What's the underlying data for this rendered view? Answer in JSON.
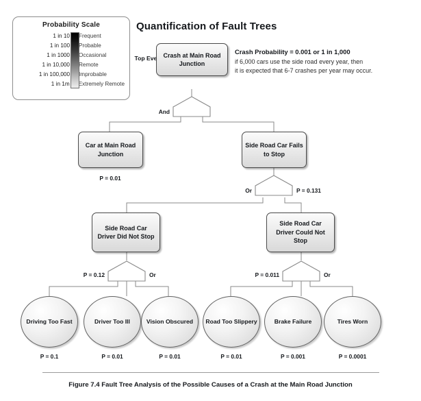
{
  "page": {
    "title": "Quantification of Fault Trees",
    "caption": "Figure 7.4 Fault Tree Analysis of the Possible Causes of a Crash at the Main Road Junction"
  },
  "legend": {
    "title": "Probability Scale",
    "rows": [
      {
        "ratio": "1 in 10",
        "word": "Frequent"
      },
      {
        "ratio": "1 in 100",
        "word": "Probable"
      },
      {
        "ratio": "1 in 1000",
        "word": "Occasional"
      },
      {
        "ratio": "1 in 10,000",
        "word": "Remote"
      },
      {
        "ratio": "1 in 100,000",
        "word": "Improbable"
      },
      {
        "ratio": "1 in 1m",
        "word": "Extremely Remote"
      }
    ],
    "gradient_top": "#000000",
    "gradient_bottom": "#efefef"
  },
  "note": {
    "headline": "Crash Probability = 0.001 or 1 in 1,000",
    "line1": "if 6,000 cars use the side road every year, then",
    "line2": "it is expected that 6-7 crashes per year may occur."
  },
  "labels": {
    "top_event": "Top Event"
  },
  "events": {
    "top": {
      "text": "Crash at Main Road Junction"
    },
    "car_at_junction": {
      "text": "Car at Main Road Junction",
      "prob": "P = 0.01"
    },
    "side_fails": {
      "text": "Side Road Car Fails to Stop"
    },
    "driver_did_not_stop": {
      "text": "Side Road Car Driver Did Not Stop"
    },
    "driver_could_not_stop": {
      "text": "Side Road Car Driver Could Not Stop"
    }
  },
  "basic_events": [
    {
      "text": "Driving Too Fast",
      "prob": "P = 0.1"
    },
    {
      "text": "Driver Too Ill",
      "prob": "P = 0.01"
    },
    {
      "text": "Vision Obscured",
      "prob": "P = 0.01"
    },
    {
      "text": "Road Too Slippery",
      "prob": "P = 0.01"
    },
    {
      "text": "Brake Failure",
      "prob": "P = 0.001"
    },
    {
      "text": "Tires Worn",
      "prob": "P = 0.0001"
    }
  ],
  "gates": {
    "top_and": {
      "type": "And",
      "prob": ""
    },
    "side_or": {
      "type": "Or",
      "prob": "P = 0.131"
    },
    "did_not_or": {
      "type": "Or",
      "prob": "P = 0.12"
    },
    "could_not_or": {
      "type": "Or",
      "prob": "P = 0.011"
    }
  },
  "chart_data": {
    "type": "diagram",
    "title": "Quantification of Fault Trees",
    "nodes": [
      {
        "id": "top",
        "label": "Crash at Main Road Junction",
        "shape": "box",
        "probability": 0.001
      },
      {
        "id": "car_at_junction",
        "label": "Car at Main Road Junction",
        "shape": "box",
        "probability": 0.01
      },
      {
        "id": "side_fails",
        "label": "Side Road Car Fails to Stop",
        "shape": "box",
        "probability": 0.131
      },
      {
        "id": "driver_did_not_stop",
        "label": "Side Road Car Driver Did Not Stop",
        "shape": "box",
        "probability": 0.12
      },
      {
        "id": "driver_could_not_stop",
        "label": "Side Road Car Driver Could Not Stop",
        "shape": "box",
        "probability": 0.011
      },
      {
        "id": "driving_too_fast",
        "label": "Driving Too Fast",
        "shape": "ellipse",
        "probability": 0.1
      },
      {
        "id": "driver_too_ill",
        "label": "Driver Too Ill",
        "shape": "ellipse",
        "probability": 0.01
      },
      {
        "id": "vision_obscured",
        "label": "Vision Obscured",
        "shape": "ellipse",
        "probability": 0.01
      },
      {
        "id": "road_too_slippery",
        "label": "Road Too Slippery",
        "shape": "ellipse",
        "probability": 0.01
      },
      {
        "id": "brake_failure",
        "label": "Brake Failure",
        "shape": "ellipse",
        "probability": 0.001
      },
      {
        "id": "tires_worn",
        "label": "Tires Worn",
        "shape": "ellipse",
        "probability": 0.0001
      }
    ],
    "gates": [
      {
        "id": "g_top",
        "type": "And",
        "parent": "top",
        "children": [
          "car_at_junction",
          "side_fails"
        ]
      },
      {
        "id": "g_side",
        "type": "Or",
        "parent": "side_fails",
        "children": [
          "driver_did_not_stop",
          "driver_could_not_stop"
        ],
        "result": 0.131
      },
      {
        "id": "g_did",
        "type": "Or",
        "parent": "driver_did_not_stop",
        "children": [
          "driving_too_fast",
          "driver_too_ill",
          "vision_obscured"
        ],
        "result": 0.12
      },
      {
        "id": "g_could",
        "type": "Or",
        "parent": "driver_could_not_stop",
        "children": [
          "road_too_slippery",
          "brake_failure",
          "tires_worn"
        ],
        "result": 0.011
      }
    ],
    "scale": {
      "ratios": [
        "1 in 10",
        "1 in 100",
        "1 in 1000",
        "1 in 10,000",
        "1 in 100,000",
        "1 in 1m"
      ],
      "words": [
        "Frequent",
        "Probable",
        "Occasional",
        "Remote",
        "Improbable",
        "Extremely Remote"
      ]
    }
  }
}
